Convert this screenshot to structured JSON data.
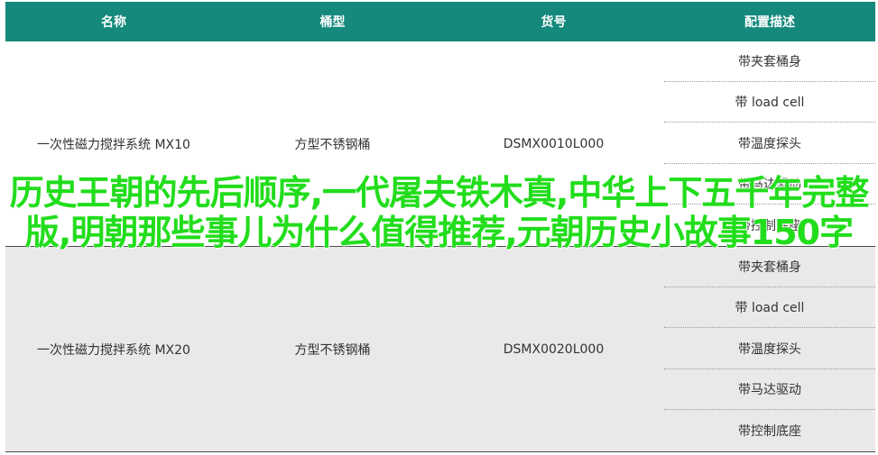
{
  "table": {
    "headers": [
      "名称",
      "桶型",
      "货号",
      "配置描述"
    ],
    "rows": [
      {
        "name": "一次性磁力搅拌系统 MX10",
        "type": "方型不锈钢桶",
        "sku": "DSMX0010L000",
        "configs": [
          "带夹套桶身",
          "带 load cell",
          "带温度探头",
          "带马达驱动",
          "带控制底座"
        ]
      },
      {
        "name": "一次性磁力搅拌系统 MX20",
        "type": "方型不锈钢桶",
        "sku": "DSMX0020L000",
        "configs": [
          "带夹套桶身",
          "带 load cell",
          "带温度探头",
          "带马达驱动",
          "带控制底座"
        ]
      }
    ]
  },
  "overlay": {
    "text": "历史王朝的先后顺序,一代屠夫铁木真,中华上下五千年完整版,明朝那些事儿为什么值得推荐,元朝历史小故事150字"
  },
  "colors": {
    "header_bg": "#14897c",
    "overlay_text": "#22dd1c",
    "alt_row_bg": "#e9e9e9"
  }
}
